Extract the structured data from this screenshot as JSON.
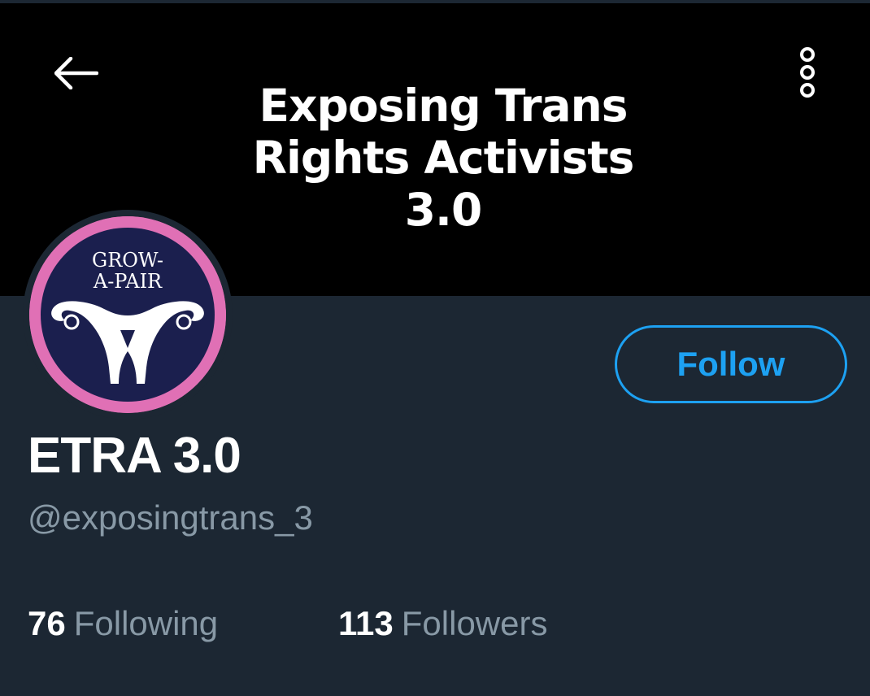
{
  "header": {
    "banner_lines": [
      "Exposing Trans",
      "Rights Activists",
      "3.0"
    ],
    "back_icon": "arrow-left-icon",
    "more_icon": "overflow-menu-icon"
  },
  "avatar": {
    "text_line1": "GROW-",
    "text_line2": "A-PAIR",
    "ring_color": "#e070b5",
    "inner_color": "#1b1f4e"
  },
  "profile": {
    "display_name": "ETRA 3.0",
    "handle": "@exposingtrans_3",
    "follow_label": "Follow"
  },
  "stats": {
    "following_count": "76",
    "following_label": "Following",
    "followers_count": "113",
    "followers_label": "Followers"
  },
  "colors": {
    "background": "#1c2733",
    "accent": "#1da1f2",
    "secondary_text": "#8899a6"
  }
}
